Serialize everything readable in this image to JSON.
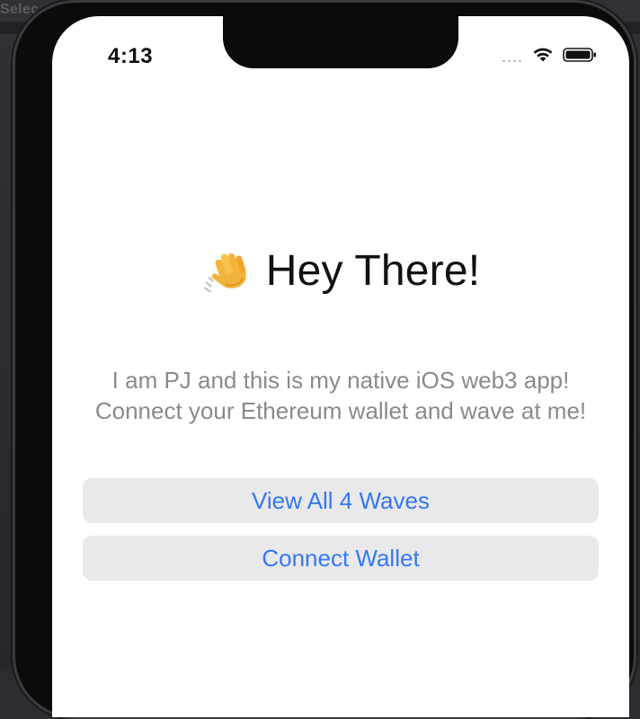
{
  "backdrop": {
    "label": "Selec"
  },
  "status_bar": {
    "time": "4:13",
    "signal": "....",
    "icons": [
      "wifi-icon",
      "battery-icon"
    ]
  },
  "hero": {
    "emoji_icon": "waving-hand-icon",
    "title": "Hey There!"
  },
  "intro": {
    "text": "I am PJ and this is my native iOS web3 app! Connect your Ethereum wallet and wave at me!"
  },
  "buttons": {
    "view_waves": "View All 4 Waves",
    "connect_wallet": "Connect Wallet"
  },
  "colors": {
    "accent": "#3478f6",
    "button_bg": "#e9e9eb",
    "body_text": "#8a8a8e",
    "title_text": "#111111"
  }
}
